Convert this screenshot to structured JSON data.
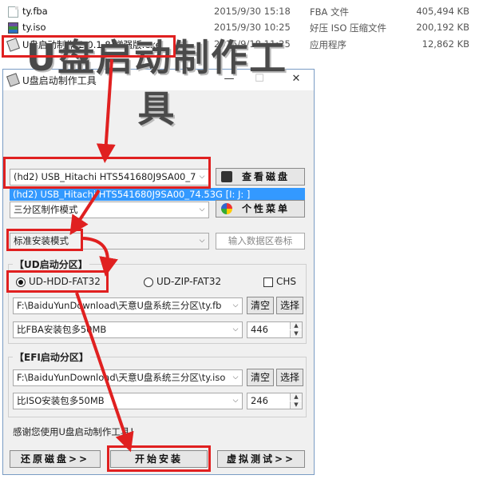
{
  "files": [
    {
      "name": "ty.fba",
      "date": "2015/9/30 15:18",
      "type": "FBA 文件",
      "size": "405,494 KB",
      "icon": "document-icon"
    },
    {
      "name": "ty.iso",
      "date": "2015/9/30 10:25",
      "type": "好压 ISO 压缩文件",
      "size": "200,192 KB",
      "icon": "archive-icon"
    },
    {
      "name": "U盘启动制作(2.0.1.8)增强版.exe",
      "date": "2015/9/18 11:25",
      "type": "应用程序",
      "size": "12,862 KB",
      "icon": "usb-exe-icon"
    }
  ],
  "window": {
    "title": "U盘启动制作工具",
    "minimize": "—",
    "maximize": "☐",
    "close": "✕",
    "banner": "U盘启动制作工具"
  },
  "device": {
    "selected": "(hd2) USB_Hitachi HTS541680J9SA00_7",
    "dropdown_option": "(hd2) USB_Hitachi HTS541680J9SA00_74.53G [I: J: ]",
    "view_disk_label": "查看磁盘"
  },
  "partition": {
    "mode": "三分区制作模式",
    "menu_label": "个性菜单"
  },
  "install": {
    "mode": "标准安装模式",
    "volume_placeholder": "输入数据区卷标"
  },
  "ud_section": {
    "title": "【UD启动分区】",
    "radio_hdd": "UD-HDD-FAT32",
    "radio_zip": "UD-ZIP-FAT32",
    "chs": "CHS",
    "path": "F:\\BaiduYunDownload\\天意U盘系统三分区\\ty.fb",
    "clear": "清空",
    "choose": "选择",
    "size_option": "比FBA安装包多50MB",
    "size_value": "446"
  },
  "efi_section": {
    "title": "【EFI启动分区】",
    "path": "F:\\BaiduYunDownload\\天意U盘系统三分区\\ty.iso",
    "clear": "清空",
    "choose": "选择",
    "size_option": "比ISO安装包多50MB",
    "size_value": "246"
  },
  "footer": {
    "thanks": "感谢您使用U盘启动制作工具！",
    "restore": "还原磁盘>>",
    "start": "开始安装",
    "virtual_test": "虚拟测试>>"
  },
  "colors": {
    "annotation_red": "#e02020",
    "selection_blue": "#3399ff"
  }
}
